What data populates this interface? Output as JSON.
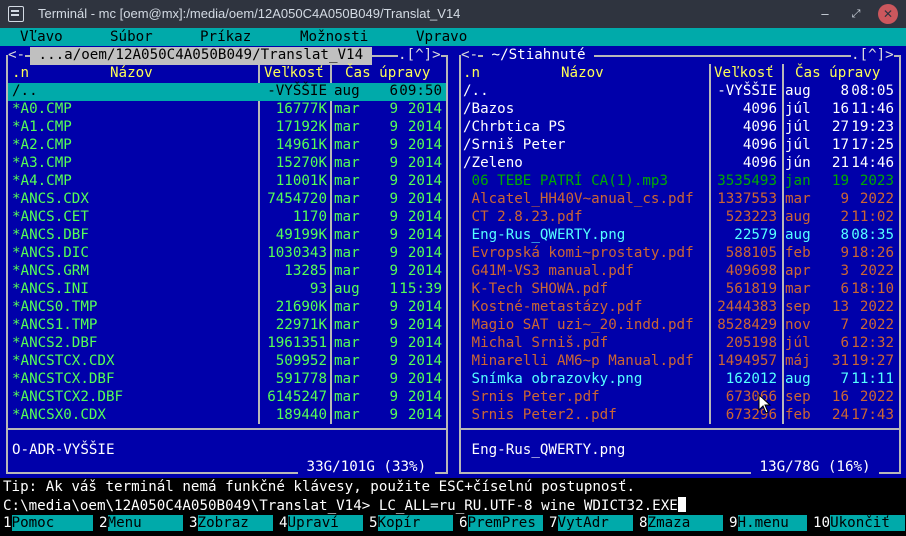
{
  "window": {
    "title": "Terminál - mc [oem@mx]:/media/oem/12A050C4A050B049/Translat_V14",
    "min_glyph": "–",
    "max_glyph": "⤢",
    "close_glyph": "✕"
  },
  "menubar": [
    "Vľavo",
    "Súbor",
    "Príkaz",
    "Možnosti",
    "Vpravo"
  ],
  "left_panel": {
    "corner_left": "<-",
    "path": " ...a/oem/12A050C4A050B049/Translat_V14 ",
    "corner_right": ".[^]>",
    "headers": {
      "n": ".n",
      "name": "Názov",
      "size": "Veľkosť",
      "mtime": "Čas úpravy"
    },
    "rows": [
      {
        "name": "/..",
        "size": "-VYŠŠIE",
        "mon": "aug",
        "day": "6",
        "time": "09:50",
        "type": "dir",
        "selected": true
      },
      {
        "name": "*A0.CMP",
        "size": "16777K",
        "mon": "mar",
        "day": "9",
        "time": "2014",
        "type": "exe"
      },
      {
        "name": "*A1.CMP",
        "size": "17192K",
        "mon": "mar",
        "day": "9",
        "time": "2014",
        "type": "exe"
      },
      {
        "name": "*A2.CMP",
        "size": "14961K",
        "mon": "mar",
        "day": "9",
        "time": "2014",
        "type": "exe"
      },
      {
        "name": "*A3.CMP",
        "size": "15270K",
        "mon": "mar",
        "day": "9",
        "time": "2014",
        "type": "exe"
      },
      {
        "name": "*A4.CMP",
        "size": "11001K",
        "mon": "mar",
        "day": "9",
        "time": "2014",
        "type": "exe"
      },
      {
        "name": "*ANCS.CDX",
        "size": "7454720",
        "mon": "mar",
        "day": "9",
        "time": "2014",
        "type": "exe"
      },
      {
        "name": "*ANCS.CET",
        "size": "1170",
        "mon": "mar",
        "day": "9",
        "time": "2014",
        "type": "exe"
      },
      {
        "name": "*ANCS.DBF",
        "size": "49199K",
        "mon": "mar",
        "day": "9",
        "time": "2014",
        "type": "exe"
      },
      {
        "name": "*ANCS.DIC",
        "size": "1030343",
        "mon": "mar",
        "day": "9",
        "time": "2014",
        "type": "exe"
      },
      {
        "name": "*ANCS.GRM",
        "size": "13285",
        "mon": "mar",
        "day": "9",
        "time": "2014",
        "type": "exe"
      },
      {
        "name": "*ANCS.INI",
        "size": "93",
        "mon": "aug",
        "day": "1",
        "time": "15:39",
        "type": "exe"
      },
      {
        "name": "*ANCS0.TMP",
        "size": "21690K",
        "mon": "mar",
        "day": "9",
        "time": "2014",
        "type": "exe"
      },
      {
        "name": "*ANCS1.TMP",
        "size": "22971K",
        "mon": "mar",
        "day": "9",
        "time": "2014",
        "type": "exe"
      },
      {
        "name": "*ANCS2.DBF",
        "size": "1961351",
        "mon": "mar",
        "day": "9",
        "time": "2014",
        "type": "exe"
      },
      {
        "name": "*ANCSTCX.CDX",
        "size": "509952",
        "mon": "mar",
        "day": "9",
        "time": "2014",
        "type": "exe"
      },
      {
        "name": "*ANCSTCX.DBF",
        "size": "591778",
        "mon": "mar",
        "day": "9",
        "time": "2014",
        "type": "exe"
      },
      {
        "name": "*ANCSTCX2.DBF",
        "size": "6145247",
        "mon": "mar",
        "day": "9",
        "time": "2014",
        "type": "exe"
      },
      {
        "name": "*ANCSX0.CDX",
        "size": "189440",
        "mon": "mar",
        "day": "9",
        "time": "2014",
        "type": "exe"
      }
    ],
    "mini_status": "O-ADR-VYŠŠIE",
    "disk": " 33G/101G (33%) "
  },
  "right_panel": {
    "corner_left": "<-",
    "path": " ~/Stiahnuté ",
    "corner_right": ".[^]>",
    "headers": {
      "n": ".n",
      "name": "Názov",
      "size": "Veľkosť",
      "mtime": "Čas úpravy"
    },
    "rows": [
      {
        "name": "/..",
        "size": "-VYŠŠIE",
        "mon": "aug",
        "day": "8",
        "time": "08:05",
        "type": "dir"
      },
      {
        "name": "/Bazos",
        "size": "4096",
        "mon": "júl",
        "day": "16",
        "time": "11:46",
        "type": "dir"
      },
      {
        "name": "/Chrbtica PS",
        "size": "4096",
        "mon": "júl",
        "day": "27",
        "time": "19:23",
        "type": "dir"
      },
      {
        "name": "/Srniš Peter",
        "size": "4096",
        "mon": "júl",
        "day": "17",
        "time": "17:25",
        "type": "dir"
      },
      {
        "name": "/Zeleno",
        "size": "4096",
        "mon": "jún",
        "day": "21",
        "time": "14:46",
        "type": "dir"
      },
      {
        "name": " 06 TEBE PATRÍ CA(1).mp3",
        "size": "3535493",
        "mon": "jan",
        "day": "19",
        "time": "2023",
        "type": "media"
      },
      {
        "name": " Alcatel_HH40V~anual_cs.pdf",
        "size": "1337553",
        "mon": "mar",
        "day": "9",
        "time": "2022",
        "type": "doc"
      },
      {
        "name": " CT 2.8.23.pdf",
        "size": "523223",
        "mon": "aug",
        "day": "2",
        "time": "11:02",
        "type": "doc"
      },
      {
        "name": " Eng-Rus_QWERTY.png",
        "size": "22579",
        "mon": "aug",
        "day": "8",
        "time": "08:35",
        "type": "img"
      },
      {
        "name": " Evropská komi~prostaty.pdf",
        "size": "588105",
        "mon": "feb",
        "day": "9",
        "time": "18:26",
        "type": "doc"
      },
      {
        "name": " G41M-VS3 manual.pdf",
        "size": "409698",
        "mon": "apr",
        "day": "3",
        "time": "2022",
        "type": "doc"
      },
      {
        "name": " K-Tech SHOWA.pdf",
        "size": "561819",
        "mon": "mar",
        "day": "6",
        "time": "18:10",
        "type": "doc"
      },
      {
        "name": " Kostné-metastázy.pdf",
        "size": "2444383",
        "mon": "sep",
        "day": "13",
        "time": "2022",
        "type": "doc"
      },
      {
        "name": " Magio SAT uzi~_20.indd.pdf",
        "size": "8528429",
        "mon": "nov",
        "day": "7",
        "time": "2022",
        "type": "doc"
      },
      {
        "name": " Michal Srniš.pdf",
        "size": "205198",
        "mon": "júl",
        "day": "6",
        "time": "12:32",
        "type": "doc"
      },
      {
        "name": " Minarelli AM6~p Manual.pdf",
        "size": "1494957",
        "mon": "máj",
        "day": "31",
        "time": "19:27",
        "type": "doc"
      },
      {
        "name": " Snímka obrazovky.png",
        "size": "162012",
        "mon": "aug",
        "day": "7",
        "time": "11:11",
        "type": "img"
      },
      {
        "name": " Srnis Peter.pdf",
        "size": "673066",
        "mon": "sep",
        "day": "16",
        "time": "2022",
        "type": "doc"
      },
      {
        "name": " Srnis Peter2..pdf",
        "size": "673296",
        "mon": "feb",
        "day": "24",
        "time": "17:43",
        "type": "doc"
      }
    ],
    "mini_status": " Eng-Rus_QWERTY.png",
    "disk": " 13G/78G (16%) "
  },
  "hint": "Tip: Ak váš terminál nemá funkčné klávesy, použite ESC+číselnú postupnosť.",
  "command_line": "C:\\media\\oem\\12A050C4A050B049\\Translat_V14> LC_ALL=ru_RU.UTF-8 wine WDICT32.EXE",
  "fkeys": [
    {
      "n": "1",
      "label": "Pomoc"
    },
    {
      "n": "2",
      "label": "Menu"
    },
    {
      "n": "3",
      "label": "Zobraz"
    },
    {
      "n": "4",
      "label": "Upraví"
    },
    {
      "n": "5",
      "label": "Kopír"
    },
    {
      "n": "6",
      "label": "PremPres"
    },
    {
      "n": "7",
      "label": "VytAdr"
    },
    {
      "n": "8",
      "label": "Zmaza"
    },
    {
      "n": "9",
      "label": "H.menu"
    },
    {
      "n": "10",
      "label": "Ukončiť"
    }
  ],
  "colors": {
    "panel_bg": "#0000aa",
    "accent": "#00aaaa",
    "header": "#ffff55",
    "exe": "#55ff55",
    "doc": "#cc6633",
    "img": "#55ffff",
    "media": "#00aa00"
  }
}
